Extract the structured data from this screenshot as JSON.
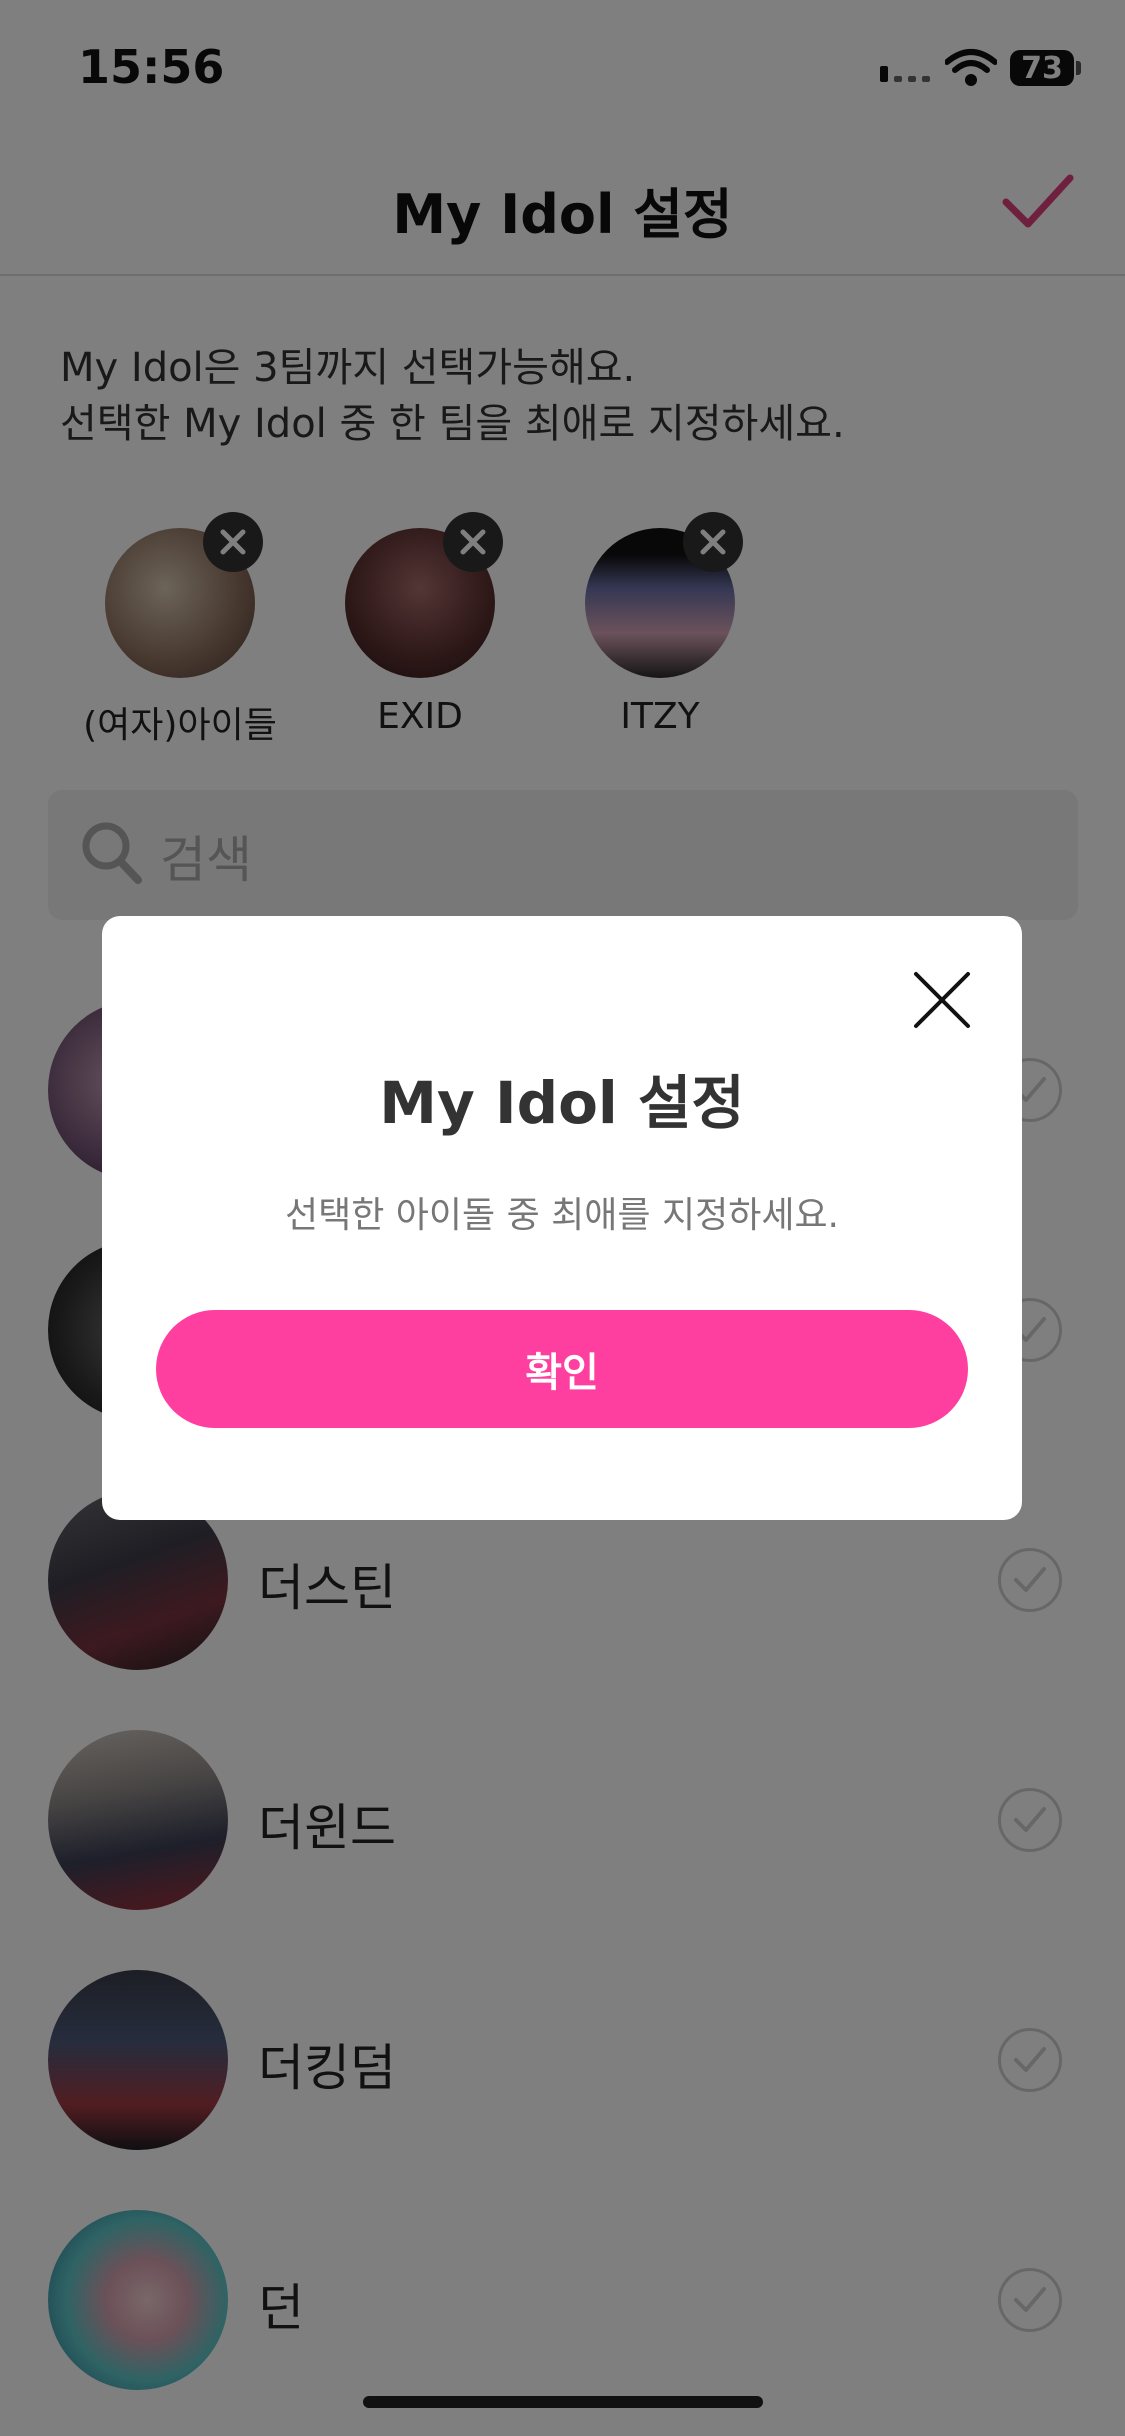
{
  "status_bar": {
    "time": "15:56",
    "battery": "73"
  },
  "header": {
    "title": "My Idol 설정"
  },
  "description": {
    "line1": "My Idol은 3팀까지 선택가능해요.",
    "line2": "선택한 My Idol 중 한 팀을 최애로 지정하세요."
  },
  "selected": [
    {
      "name": "(여자)아이들"
    },
    {
      "name": "EXID"
    },
    {
      "name": "ITZY"
    }
  ],
  "search": {
    "placeholder": "검색"
  },
  "list": [
    {
      "name": ""
    },
    {
      "name": ""
    },
    {
      "name": "더스틴"
    },
    {
      "name": "더윈드"
    },
    {
      "name": "더킹덤"
    },
    {
      "name": "던"
    }
  ],
  "modal": {
    "title": "My Idol 설정",
    "message": "선택한 아이돌 중 최애를 지정하세요.",
    "confirm": "확인"
  },
  "colors": {
    "accent": "#ff3fa0",
    "check": "#e0407e"
  },
  "icons": {
    "header_check": "checkmark-icon",
    "remove": "close-icon",
    "search": "search-icon",
    "modal_close": "close-icon"
  }
}
